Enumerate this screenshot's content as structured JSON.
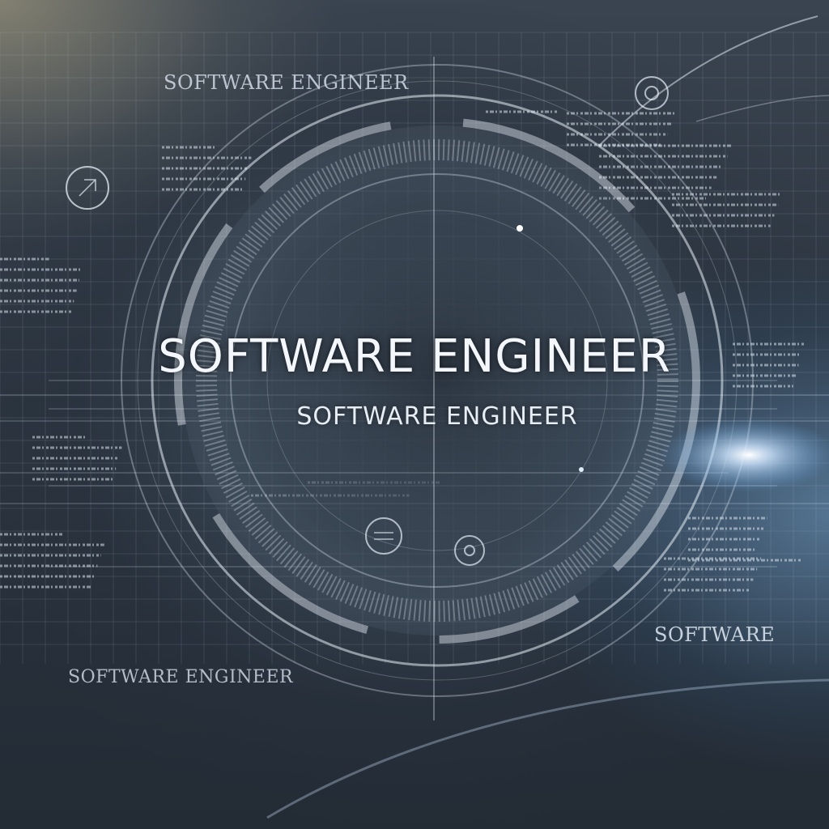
{
  "labels": {
    "main_title": "SOFTWARE ENGINEER",
    "subtitle": "SOFTWARE ENGINEER",
    "top_left": "SOFTWARE ENGINEER",
    "bottom_left": "SOFTWARE ENGINEER",
    "bottom_right": "SOFTWARE"
  },
  "colors": {
    "background_dark": "#232b35",
    "background_mid": "#3a4450",
    "glow_warm": "#beb28c",
    "glow_cool": "#78aad7",
    "lens_flare": "#cfe6ff",
    "line_light": "#dfe8f2"
  },
  "icons": [
    "target-crosshair-icon",
    "target-circle-icon",
    "shield-emblem-icon",
    "camera-lens-icon"
  ]
}
